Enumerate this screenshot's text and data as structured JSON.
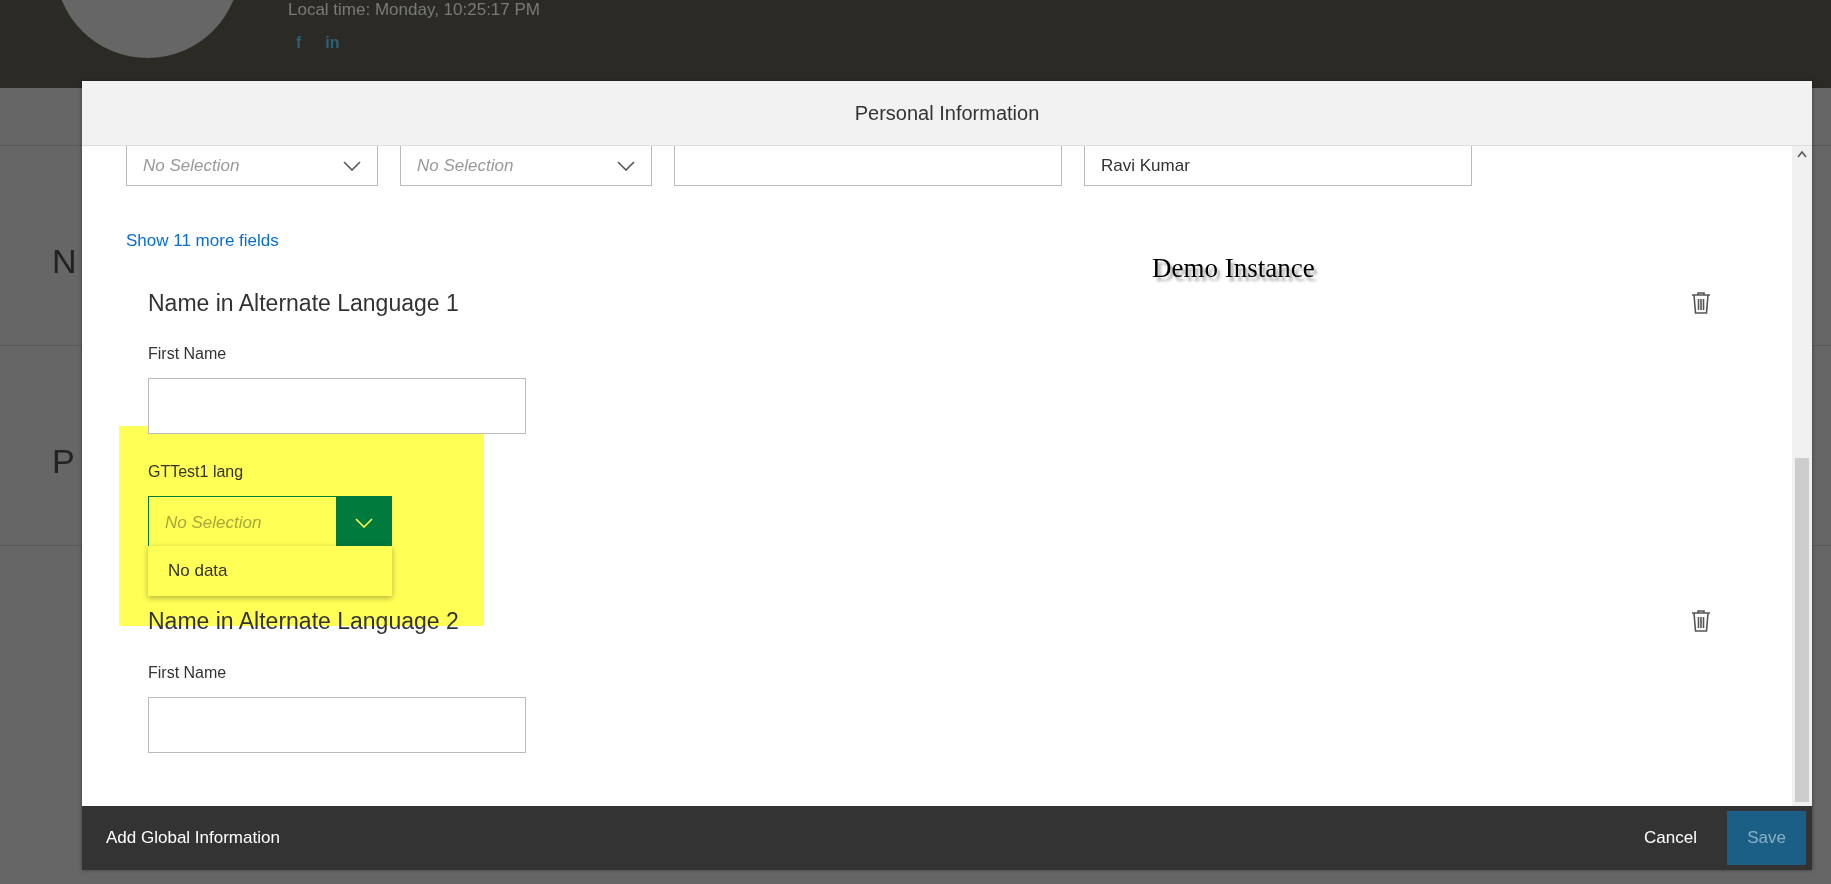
{
  "profile_header": {
    "local_time": "Local time: Monday, 10:25:17 PM",
    "social_links": [
      {
        "label": "f"
      },
      {
        "label": "in"
      }
    ]
  },
  "background_sections": [
    "N",
    "P"
  ],
  "dialog": {
    "title": "Personal Information",
    "top_fields": [
      {
        "kind": "select",
        "placeholder": "No Selection"
      },
      {
        "kind": "select",
        "placeholder": "No Selection"
      },
      {
        "kind": "input"
      },
      {
        "kind": "input",
        "value": "Ravi Kumar"
      }
    ],
    "show_more_link": "Show 11 more fields",
    "overlay_label": "Demo Instance",
    "sections": [
      {
        "title": "Name in Alternate Language 1",
        "fields": [
          {
            "kind": "input",
            "label": "First Name"
          },
          {
            "kind": "select",
            "label": "GTTest1 lang",
            "placeholder": "No Selection",
            "highlighted": true,
            "expanded": true,
            "options_message": "No data"
          }
        ]
      },
      {
        "title": "Name in Alternate Language 2",
        "fields": [
          {
            "kind": "input",
            "label": "First Name"
          }
        ]
      }
    ],
    "footer": {
      "title": "Add Global Information",
      "cancel": "Cancel",
      "save": "Save",
      "save_disabled": true
    }
  }
}
